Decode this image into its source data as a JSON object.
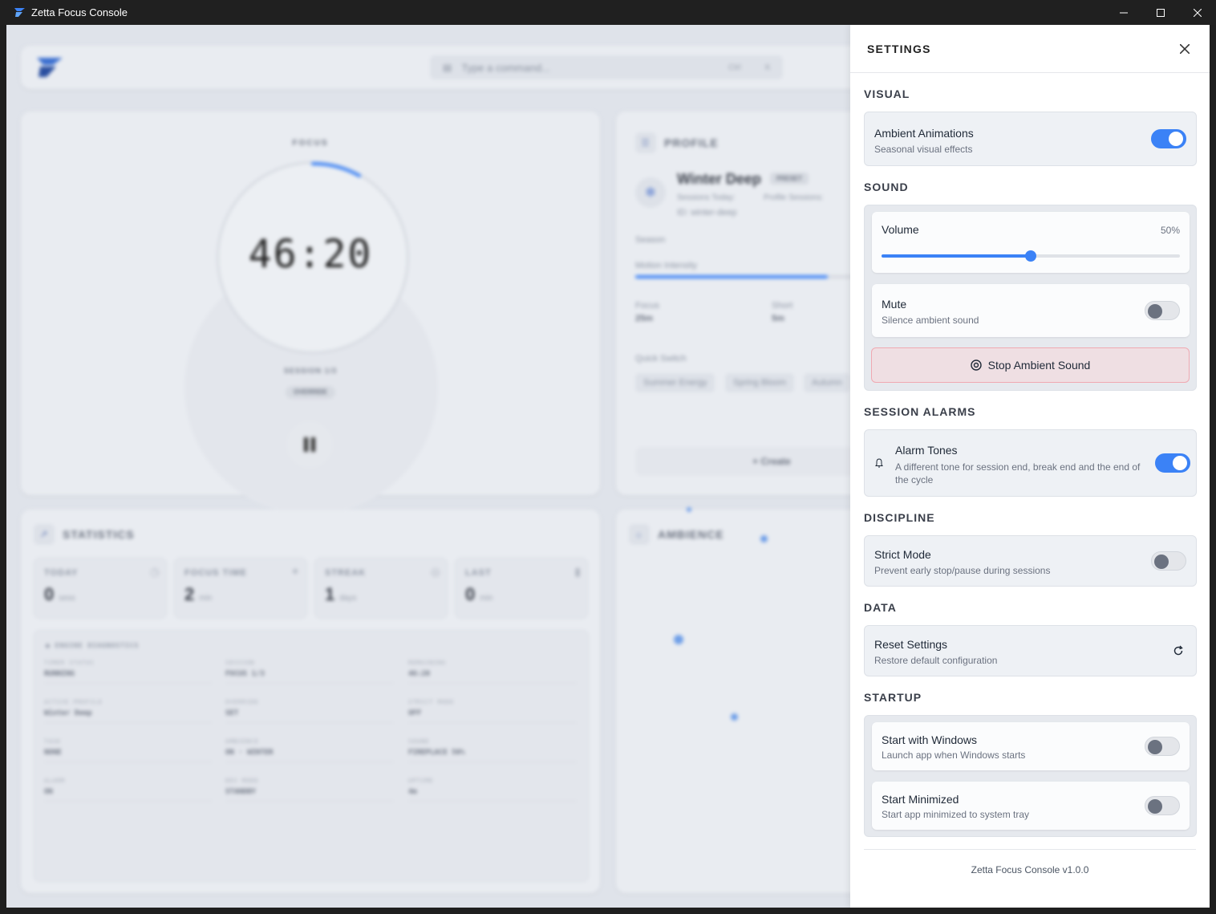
{
  "window": {
    "title": "Zetta Focus Console"
  },
  "topbar": {
    "command_placeholder": "Type a command...",
    "shortcut_ctrl": "Ctrl",
    "shortcut_key": "K"
  },
  "focus": {
    "label": "FOCUS",
    "timer": "46:20",
    "session": "SESSION 1/3",
    "badge": "OVERRIDE"
  },
  "profile": {
    "header": "PROFILE",
    "name": "Winter Deep",
    "preset_badge": "PRESET",
    "sessions_today": "Sessions Today:",
    "profile_sessions": "Profile Sessions:",
    "id": "ID: winter-deep",
    "season_label": "Season",
    "motion_label": "Motion Intensity",
    "motion_level": 0.8,
    "focus_label": "Focus",
    "focus_value": "25m",
    "short_label": "Short",
    "short_value": "5m",
    "quick_switch_label": "Quick Switch",
    "quick_switch": [
      "Summer Energy",
      "Spring Bloom",
      "Autumn"
    ],
    "create_label": "+ Create"
  },
  "statistics": {
    "header": "STATISTICS",
    "cards": [
      {
        "label": "TODAY",
        "value": "0",
        "unit": "sess"
      },
      {
        "label": "FOCUS TIME",
        "value": "2",
        "unit": "min"
      },
      {
        "label": "STREAK",
        "value": "1",
        "unit": "days"
      },
      {
        "label": "LAST",
        "value": "0",
        "unit": "min"
      }
    ],
    "diagnostics_title": "● ENGINE DIAGNOSTICS",
    "diagnostics": [
      {
        "key": "TIMER STATUS",
        "value": "RUNNING"
      },
      {
        "key": "SESSION",
        "value": "FOCUS 1/3"
      },
      {
        "key": "REMAINING",
        "value": "46:20"
      },
      {
        "key": "ACTIVE PROFILE",
        "value": "Winter Deep"
      },
      {
        "key": "OVERRIDE",
        "value": "SET"
      },
      {
        "key": "STRICT MODE",
        "value": "OFF"
      },
      {
        "key": "TASK",
        "value": "NONE"
      },
      {
        "key": "AMBIENCE",
        "value": "ON · WINTER"
      },
      {
        "key": "SOUND",
        "value": "FIREPLACE 50%"
      },
      {
        "key": "ALARM",
        "value": "ON"
      },
      {
        "key": "DEV MODE",
        "value": "STANDBY"
      },
      {
        "key": "UPTIME",
        "value": "4m"
      }
    ]
  },
  "ambience": {
    "header": "AMBIENCE"
  },
  "settings": {
    "title": "SETTINGS",
    "visual": {
      "label": "VISUAL",
      "ambient_title": "Ambient Animations",
      "ambient_sub": "Seasonal visual effects",
      "ambient_on": true
    },
    "sound": {
      "label": "SOUND",
      "volume_title": "Volume",
      "volume_value": "50%",
      "volume_level": 0.5,
      "mute_title": "Mute",
      "mute_sub": "Silence ambient sound",
      "mute_on": false,
      "stop_label": "Stop Ambient Sound"
    },
    "alarms": {
      "label": "SESSION ALARMS",
      "title": "Alarm Tones",
      "sub": "A different tone for session end, break end and the end of the cycle",
      "on": true
    },
    "discipline": {
      "label": "DISCIPLINE",
      "title": "Strict Mode",
      "sub": "Prevent early stop/pause during sessions",
      "on": false
    },
    "data": {
      "label": "DATA",
      "title": "Reset Settings",
      "sub": "Restore default configuration"
    },
    "startup": {
      "label": "STARTUP",
      "windows_title": "Start with Windows",
      "windows_sub": "Launch app when Windows starts",
      "windows_on": false,
      "minimized_title": "Start Minimized",
      "minimized_sub": "Start app minimized to system tray",
      "minimized_on": false
    },
    "version": "Zetta Focus Console v1.0.0"
  },
  "colors": {
    "accent": "#3b82f6",
    "danger_border": "#f0a9b2",
    "danger_bg": "#efdfe3"
  }
}
